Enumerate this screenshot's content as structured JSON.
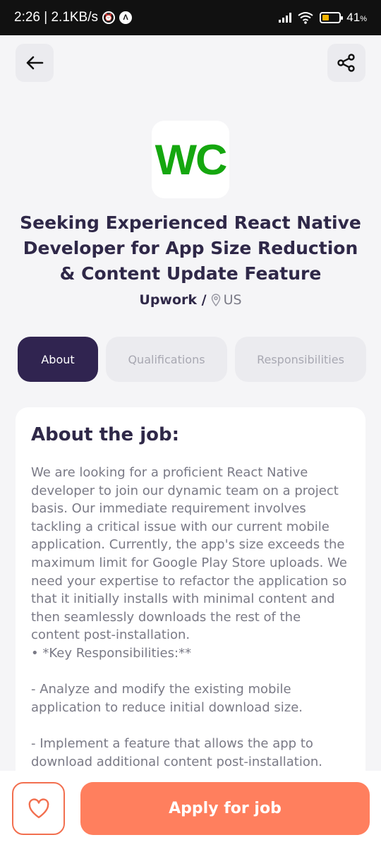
{
  "status_bar": {
    "time_speed": "2:26 | 2.1KB/s",
    "battery_percent": "41",
    "battery_unit": "%",
    "battery_level": 0.41,
    "icons": [
      "alarm-icon",
      "app-a-icon",
      "signal-icon",
      "wifi-icon",
      "battery-icon"
    ]
  },
  "header": {
    "back_icon": "arrow-left-icon",
    "share_icon": "share-icon"
  },
  "job": {
    "logo_text": "WC",
    "logo_color": "#15a70f",
    "title": "Seeking Experienced React Native Developer for App Size Reduction & Content Update Feature",
    "company": "Upwork /",
    "location": "US"
  },
  "tabs": [
    {
      "label": "About",
      "active": true
    },
    {
      "label": "Qualifications",
      "active": false
    },
    {
      "label": "Responsibilities",
      "active": false
    }
  ],
  "about": {
    "heading": "About the job:",
    "paragraph": "We are looking for a proficient React Native developer to join our dynamic team on a project basis. Our immediate requirement involves tackling a critical issue with our current mobile application. Currently, the app's size exceeds the maximum limit for Google Play Store uploads. We need your expertise to refactor the application so that it initially installs with minimal content and then seamlessly downloads the rest of the content post-installation.",
    "key_heading": "• *Key Responsibilities:**",
    "item1": "- Analyze and modify the existing mobile application to reduce initial download size.",
    "item2": "- Implement a feature that allows the app to download additional content post-installation."
  },
  "footer": {
    "favorite_icon": "heart-icon",
    "apply_label": "Apply for job"
  },
  "colors": {
    "primary": "#302450",
    "accent": "#ff7f5e",
    "accent_border": "#f26f4f",
    "text_dark": "#2f2848",
    "text_muted": "#7a7a86"
  }
}
